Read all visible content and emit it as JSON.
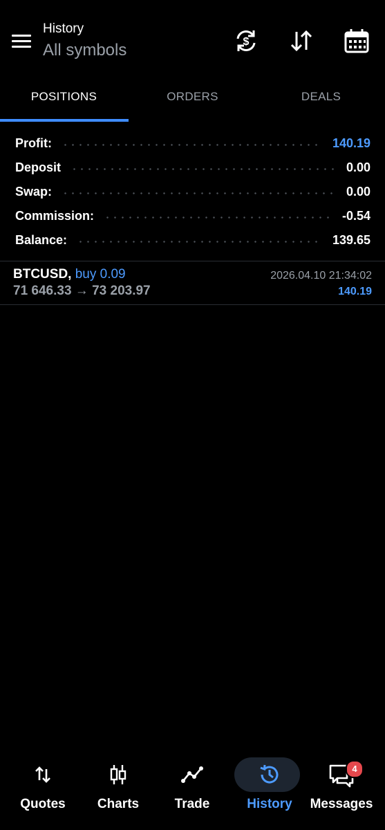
{
  "header": {
    "title": "History",
    "subtitle": "All symbols",
    "icons": [
      "menu-icon",
      "currency-exchange-icon",
      "sort-icon",
      "calendar-icon"
    ]
  },
  "tabs": [
    {
      "label": "POSITIONS",
      "active": true
    },
    {
      "label": "ORDERS",
      "active": false
    },
    {
      "label": "DEALS",
      "active": false
    }
  ],
  "summary": {
    "profit": {
      "label": "Profit:",
      "value": "140.19"
    },
    "deposit": {
      "label": "Deposit",
      "value": "0.00"
    },
    "swap": {
      "label": "Swap:",
      "value": "0.00"
    },
    "commission": {
      "label": "Commission:",
      "value": "-0.54"
    },
    "balance": {
      "label": "Balance:",
      "value": "139.65"
    }
  },
  "positions": [
    {
      "symbol": "BTCUSD,",
      "type": "buy 0.09",
      "prices": "71 646.33 → 73 203.97",
      "time": "2026.04.10 21:34:02",
      "profit": "140.19"
    }
  ],
  "bottom_nav": [
    {
      "label": "Quotes",
      "icon": "quotes-icon",
      "active": false
    },
    {
      "label": "Charts",
      "icon": "candlestick-icon",
      "active": false
    },
    {
      "label": "Trade",
      "icon": "trade-line-icon",
      "active": false
    },
    {
      "label": "History",
      "icon": "history-icon",
      "active": true
    },
    {
      "label": "Messages",
      "icon": "messages-icon",
      "active": false,
      "badge": "4"
    }
  ],
  "colors": {
    "background": "#000000",
    "accent": "#4d9bff",
    "muted_text": "#9aa0a8",
    "badge": "#e5484d"
  }
}
